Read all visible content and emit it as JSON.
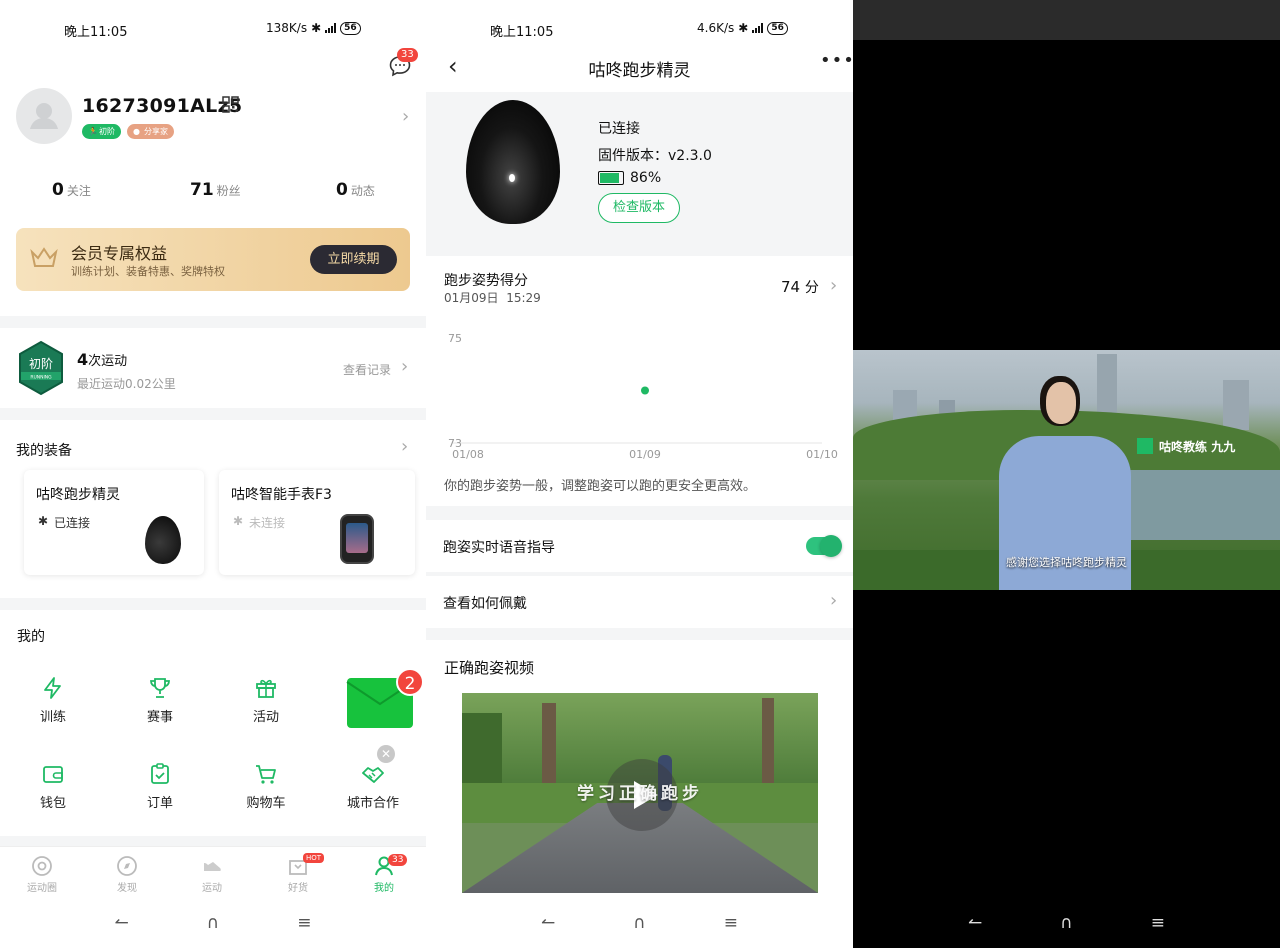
{
  "panel1": {
    "status": {
      "time": "晚上11:05",
      "speed": "138K/s",
      "net": "4G",
      "battery": "56"
    },
    "messages_badge": "33",
    "profile": {
      "username": "16273091ALz5",
      "tag_level": "初阶",
      "tag_sharer": "分享家"
    },
    "stats": [
      {
        "num": "0",
        "label": "关注"
      },
      {
        "num": "71",
        "label": "粉丝"
      },
      {
        "num": "0",
        "label": "动态"
      }
    ],
    "vip": {
      "title": "会员专属权益",
      "subtitle": "训练计划、装备特惠、奖牌特权",
      "button": "立即续期"
    },
    "activity": {
      "medal_text": "初阶",
      "medal_sub": "RUNNING",
      "count": "4",
      "count_label": "次运动",
      "recent": "最近运动0.02公里",
      "link": "查看记录"
    },
    "equipment": {
      "title": "我的装备",
      "devices": [
        {
          "name": "咕咚跑步精灵",
          "status": "已连接"
        },
        {
          "name": "咕咚智能手表F3",
          "status": "未连接"
        }
      ]
    },
    "mine": {
      "title": "我的",
      "items": [
        "训练",
        "赛事",
        "活动",
        "钱包",
        "订单",
        "购物车",
        "城市合作"
      ],
      "promo_badge": "2"
    },
    "tabs": [
      {
        "label": "运动圈"
      },
      {
        "label": "发现"
      },
      {
        "label": "运动"
      },
      {
        "label": "好货",
        "badge": "HOT"
      },
      {
        "label": "我的",
        "badge": "33"
      }
    ],
    "accent_color": "#1fb964"
  },
  "panel2": {
    "status": {
      "time": "晚上11:05",
      "speed": "4.6K/s",
      "net": "4G",
      "battery": "56"
    },
    "title": "咕咚跑步精灵",
    "device": {
      "state": "已连接",
      "firmware_label": "固件版本：",
      "firmware": "v2.3.0",
      "battery": "86%",
      "battery_level": 0.86,
      "check_button": "检查版本"
    },
    "score": {
      "title": "跑步姿势得分",
      "date": "01月09日",
      "time": "15:29",
      "value": "74",
      "unit": "分",
      "comment": "你的跑步姿势一般，调整跑姿可以跑的更安全更高效。"
    },
    "chart_data": {
      "type": "scatter",
      "x": [
        "01/09"
      ],
      "y": [
        74
      ],
      "categories": [
        "01/08",
        "01/09",
        "01/10"
      ],
      "ylim": [
        73,
        75
      ],
      "yticks": [
        "75",
        "73"
      ],
      "color": "#1fb964"
    },
    "voice_guide": {
      "label": "跑姿实时语音指导",
      "enabled": true
    },
    "how_to_wear": "查看如何佩戴",
    "video_section": {
      "title": "正确跑姿视频",
      "overlay": "学习正确跑步"
    }
  },
  "panel3": {
    "coach_label": "咕咚教练",
    "coach_name": "九九",
    "subtitle": "感谢您选择咕咚跑步精灵"
  }
}
